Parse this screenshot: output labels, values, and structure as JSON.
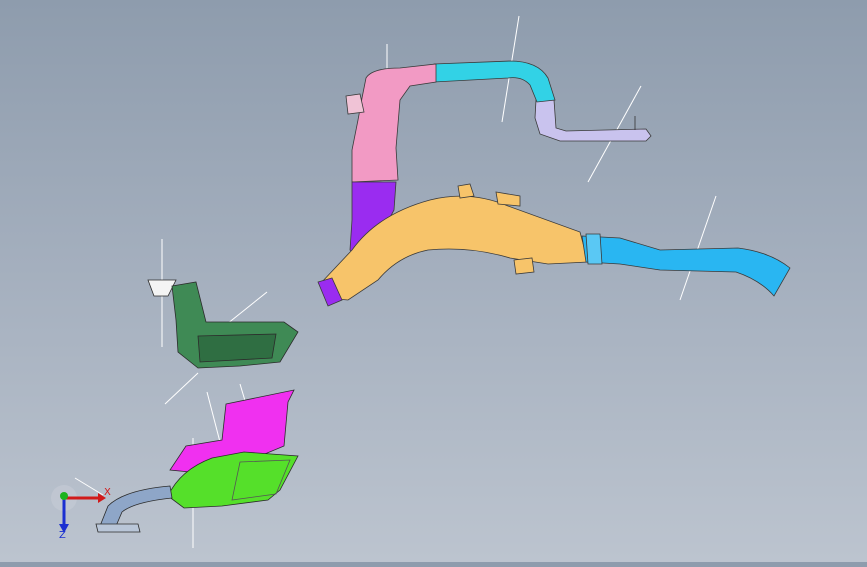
{
  "viewport": {
    "background_top": "#8e9cad",
    "background_bottom": "#bcc4cf"
  },
  "triad": {
    "x_label": "X",
    "z_label": "Z",
    "x_color": "#d11a1a",
    "y_color": "#1db31d",
    "z_color": "#1a2fd1"
  },
  "parts": [
    {
      "name": "upper-duct-pink",
      "color": "#f29ac4"
    },
    {
      "name": "upper-duct-cyan",
      "color": "#32d2e6"
    },
    {
      "name": "upper-duct-lavender",
      "color": "#c9c3ee"
    },
    {
      "name": "riser-duct-purple",
      "color": "#9a2cf0"
    },
    {
      "name": "main-duct-orange",
      "color": "#f7c46a"
    },
    {
      "name": "main-duct-blue",
      "color": "#29b6f2"
    },
    {
      "name": "housing-dark-green",
      "color": "#3f8a55"
    },
    {
      "name": "panel-magenta",
      "color": "#f030f0"
    },
    {
      "name": "housing-lime-green",
      "color": "#55e02a"
    },
    {
      "name": "hose-grey-blue",
      "color": "#8ea6c8"
    }
  ]
}
